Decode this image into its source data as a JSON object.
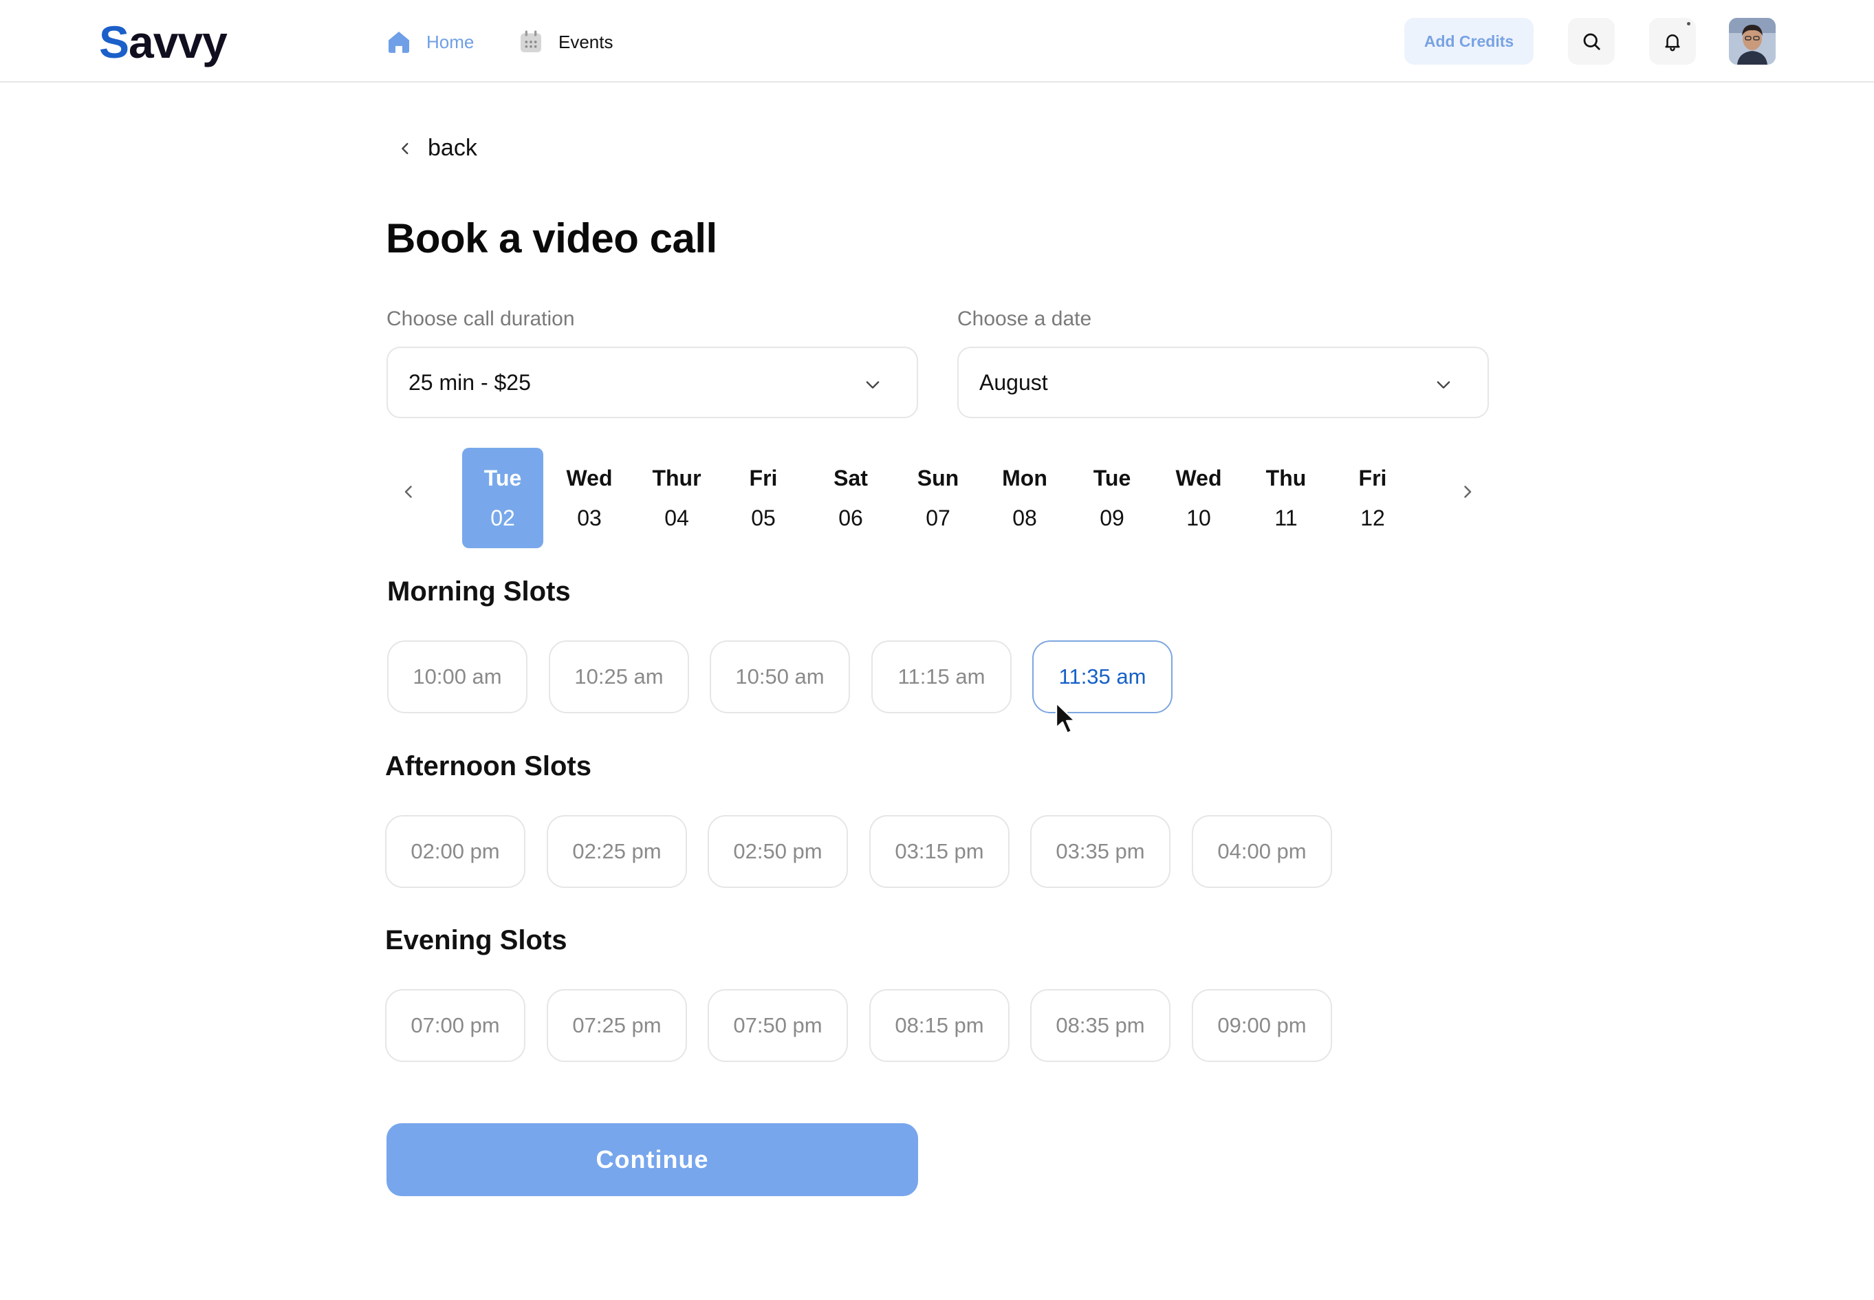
{
  "header": {
    "logo_initial": "S",
    "logo_rest": "avvy",
    "nav": [
      {
        "label": "Home",
        "icon": "home-icon",
        "active": true
      },
      {
        "label": "Events",
        "icon": "calendar-icon",
        "active": false
      }
    ],
    "add_credits_label": "Add Credits",
    "search_icon": "search-icon",
    "bell_icon": "bell-icon",
    "avatar": "user-avatar"
  },
  "main": {
    "back_label": "back",
    "title": "Book a video call",
    "duration": {
      "label": "Choose call duration",
      "value": "25 min - $25"
    },
    "date": {
      "label": "Choose a date",
      "value": "August"
    },
    "days": [
      {
        "name": "Tue",
        "num": "02",
        "selected": true
      },
      {
        "name": "Wed",
        "num": "03"
      },
      {
        "name": "Thur",
        "num": "04"
      },
      {
        "name": "Fri",
        "num": "05"
      },
      {
        "name": "Sat",
        "num": "06"
      },
      {
        "name": "Sun",
        "num": "07"
      },
      {
        "name": "Mon",
        "num": "08"
      },
      {
        "name": "Tue",
        "num": "09"
      },
      {
        "name": "Wed",
        "num": "10"
      },
      {
        "name": "Thu",
        "num": "11"
      },
      {
        "name": "Fri",
        "num": "12"
      }
    ],
    "morning": {
      "title": "Morning Slots",
      "slots": [
        "10:00 am",
        "10:25 am",
        "10:50 am",
        "11:15 am",
        "11:35 am"
      ],
      "active_index": 4
    },
    "afternoon": {
      "title": "Afternoon Slots",
      "slots": [
        "02:00 pm",
        "02:25 pm",
        "02:50 pm",
        "03:15 pm",
        "03:35 pm",
        "04:00 pm"
      ]
    },
    "evening": {
      "title": "Evening Slots",
      "slots": [
        "07:00 pm",
        "07:25 pm",
        "07:50 pm",
        "08:15 pm",
        "08:35 pm",
        "09:00 pm"
      ]
    },
    "continue_label": "Continue"
  },
  "colors": {
    "accent": "#78a8eb",
    "accent_text": "#1560c7",
    "muted_text": "#8a8a8a",
    "border": "#e6e6e6"
  }
}
